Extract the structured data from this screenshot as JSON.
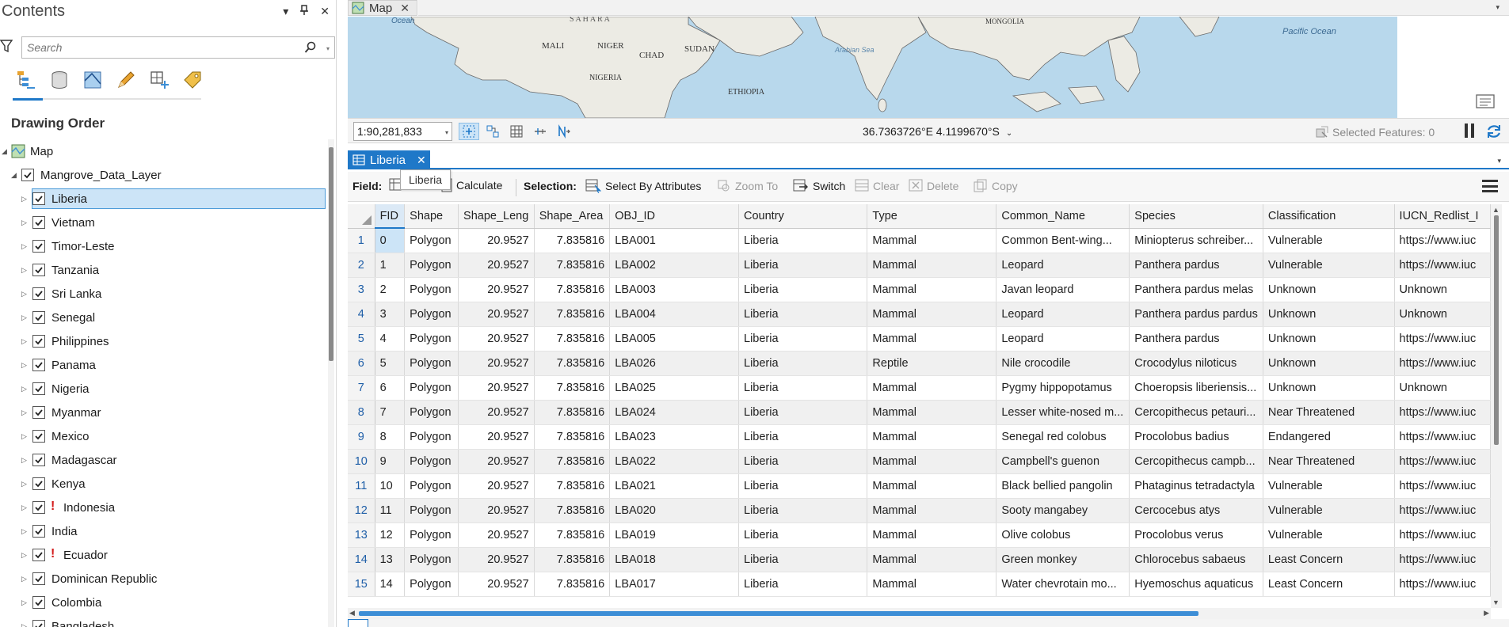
{
  "contents": {
    "title": "Contents",
    "search_placeholder": "Search",
    "section_title": "Drawing Order",
    "map_label": "Map",
    "group_label": "Mangrove_Data_Layer",
    "layers": [
      {
        "label": "Liberia",
        "selected": true,
        "warning": false
      },
      {
        "label": "Vietnam",
        "selected": false,
        "warning": false
      },
      {
        "label": "Timor-Leste",
        "selected": false,
        "warning": false
      },
      {
        "label": "Tanzania",
        "selected": false,
        "warning": false
      },
      {
        "label": "Sri Lanka",
        "selected": false,
        "warning": false
      },
      {
        "label": "Senegal",
        "selected": false,
        "warning": false
      },
      {
        "label": "Philippines",
        "selected": false,
        "warning": false
      },
      {
        "label": "Panama",
        "selected": false,
        "warning": false
      },
      {
        "label": "Nigeria",
        "selected": false,
        "warning": false
      },
      {
        "label": "Myanmar",
        "selected": false,
        "warning": false
      },
      {
        "label": "Mexico",
        "selected": false,
        "warning": false
      },
      {
        "label": "Madagascar",
        "selected": false,
        "warning": false
      },
      {
        "label": "Kenya",
        "selected": false,
        "warning": false
      },
      {
        "label": "Indonesia",
        "selected": false,
        "warning": true
      },
      {
        "label": "India",
        "selected": false,
        "warning": false
      },
      {
        "label": "Ecuador",
        "selected": false,
        "warning": true
      },
      {
        "label": "Dominican Republic",
        "selected": false,
        "warning": false
      },
      {
        "label": "Colombia",
        "selected": false,
        "warning": false
      },
      {
        "label": "Bangladesh",
        "selected": false,
        "warning": false
      }
    ]
  },
  "map": {
    "tab_label": "Map",
    "scale": "1:90,281,833",
    "coordinates": "36.7363726°E 4.1199670°S",
    "selected_features": "Selected Features: 0",
    "labels": {
      "ocean_left": "Ocean",
      "sahara": "S A H A R A",
      "mali": "MALI",
      "niger": "NIGER",
      "chad": "CHAD",
      "sudan": "SUDAN",
      "nigeria": "NIGERIA",
      "ethiopia": "ETHIOPIA",
      "arabian_sea": "Arabian Sea",
      "mongolia": "MONGOLIA",
      "pacific": "Pacific Ocean"
    }
  },
  "table": {
    "tab_label": "Liberia",
    "tooltip": "Liberia",
    "toolbar": {
      "field_label": "Field:",
      "calculate": "Calculate",
      "selection_label": "Selection:",
      "select_by_attributes": "Select By Attributes",
      "zoom_to": "Zoom To",
      "switch": "Switch",
      "clear": "Clear",
      "delete": "Delete",
      "copy": "Copy"
    },
    "columns": [
      "FID",
      "Shape",
      "Shape_Leng",
      "Shape_Area",
      "OBJ_ID",
      "Country",
      "Type",
      "Common_Name",
      "Species",
      "Classification",
      "IUCN_Redlist_I"
    ],
    "rows": [
      [
        "0",
        "Polygon",
        "20.9527",
        "7.835816",
        "LBA001",
        "Liberia",
        "Mammal",
        "Common Bent-wing...",
        "Miniopterus schreiber...",
        "Vulnerable",
        "https://www.iuc"
      ],
      [
        "1",
        "Polygon",
        "20.9527",
        "7.835816",
        "LBA002",
        "Liberia",
        "Mammal",
        "Leopard",
        "Panthera pardus",
        "Vulnerable",
        "https://www.iuc"
      ],
      [
        "2",
        "Polygon",
        "20.9527",
        "7.835816",
        "LBA003",
        "Liberia",
        "Mammal",
        "Javan leopard",
        "Panthera pardus melas",
        "Unknown",
        "Unknown"
      ],
      [
        "3",
        "Polygon",
        "20.9527",
        "7.835816",
        "LBA004",
        "Liberia",
        "Mammal",
        "Leopard",
        "Panthera pardus pardus",
        "Unknown",
        "Unknown"
      ],
      [
        "4",
        "Polygon",
        "20.9527",
        "7.835816",
        "LBA005",
        "Liberia",
        "Mammal",
        "Leopard",
        "Panthera pardus",
        "Unknown",
        "https://www.iuc"
      ],
      [
        "5",
        "Polygon",
        "20.9527",
        "7.835816",
        "LBA026",
        "Liberia",
        "Reptile",
        "Nile crocodile",
        "Crocodylus niloticus",
        "Unknown",
        "https://www.iuc"
      ],
      [
        "6",
        "Polygon",
        "20.9527",
        "7.835816",
        "LBA025",
        "Liberia",
        "Mammal",
        "Pygmy hippopotamus",
        "Choeropsis liberiensis...",
        "Unknown",
        "Unknown"
      ],
      [
        "7",
        "Polygon",
        "20.9527",
        "7.835816",
        "LBA024",
        "Liberia",
        "Mammal",
        "Lesser white-nosed m...",
        "Cercopithecus petauri...",
        "Near Threatened",
        "https://www.iuc"
      ],
      [
        "8",
        "Polygon",
        "20.9527",
        "7.835816",
        "LBA023",
        "Liberia",
        "Mammal",
        "Senegal red colobus",
        "Procolobus badius",
        "Endangered",
        "https://www.iuc"
      ],
      [
        "9",
        "Polygon",
        "20.9527",
        "7.835816",
        "LBA022",
        "Liberia",
        "Mammal",
        "Campbell's guenon",
        "Cercopithecus campb...",
        "Near Threatened",
        "https://www.iuc"
      ],
      [
        "10",
        "Polygon",
        "20.9527",
        "7.835816",
        "LBA021",
        "Liberia",
        "Mammal",
        "Black bellied pangolin",
        "Phataginus tetradactyla",
        "Vulnerable",
        "https://www.iuc"
      ],
      [
        "11",
        "Polygon",
        "20.9527",
        "7.835816",
        "LBA020",
        "Liberia",
        "Mammal",
        "Sooty mangabey",
        "Cercocebus atys",
        "Vulnerable",
        "https://www.iuc"
      ],
      [
        "12",
        "Polygon",
        "20.9527",
        "7.835816",
        "LBA019",
        "Liberia",
        "Mammal",
        "Olive colobus",
        "Procolobus verus",
        "Vulnerable",
        "https://www.iuc"
      ],
      [
        "13",
        "Polygon",
        "20.9527",
        "7.835816",
        "LBA018",
        "Liberia",
        "Mammal",
        "Green monkey",
        "Chlorocebus sabaeus",
        "Least Concern",
        "https://www.iuc"
      ],
      [
        "14",
        "Polygon",
        "20.9527",
        "7.835816",
        "LBA017",
        "Liberia",
        "Mammal",
        "Water chevrotain mo...",
        "Hyemoschus aquaticus",
        "Least Concern",
        "https://www.iuc"
      ]
    ]
  },
  "colors": {
    "accent": "#1f78c8",
    "selection": "#cce4f7",
    "warning": "#d31c1c",
    "ocean": "#b8d8ec",
    "land": "#ecebe4"
  }
}
